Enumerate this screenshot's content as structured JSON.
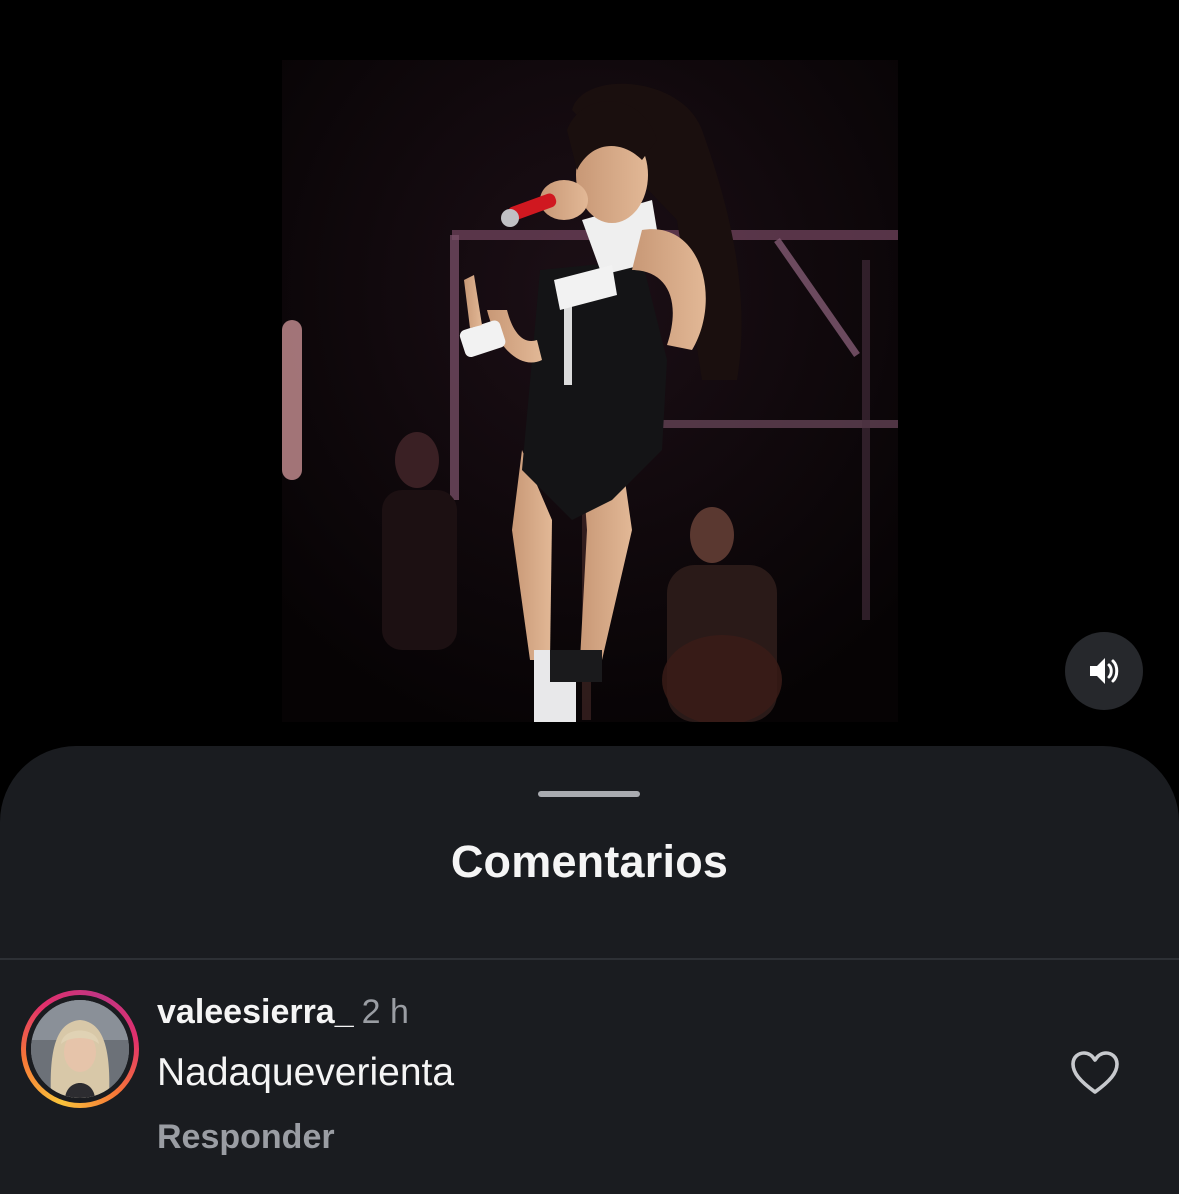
{
  "video": {
    "mute_icon": "speaker-volume-icon"
  },
  "comments_sheet": {
    "title": "Comentarios",
    "comments": [
      {
        "username": "valeesierra_",
        "time": "2 h",
        "text": "Nadaqueverienta",
        "reply_label": "Responder",
        "like_icon": "heart-outline-icon",
        "avatar_ring_colors": [
          "#f9c33b",
          "#f77737",
          "#e1306c",
          "#c13584"
        ]
      }
    ]
  },
  "colors": {
    "background": "#000000",
    "sheet": "#1a1c20",
    "text_primary": "#f5f5f5",
    "text_secondary": "#9a9da3"
  }
}
